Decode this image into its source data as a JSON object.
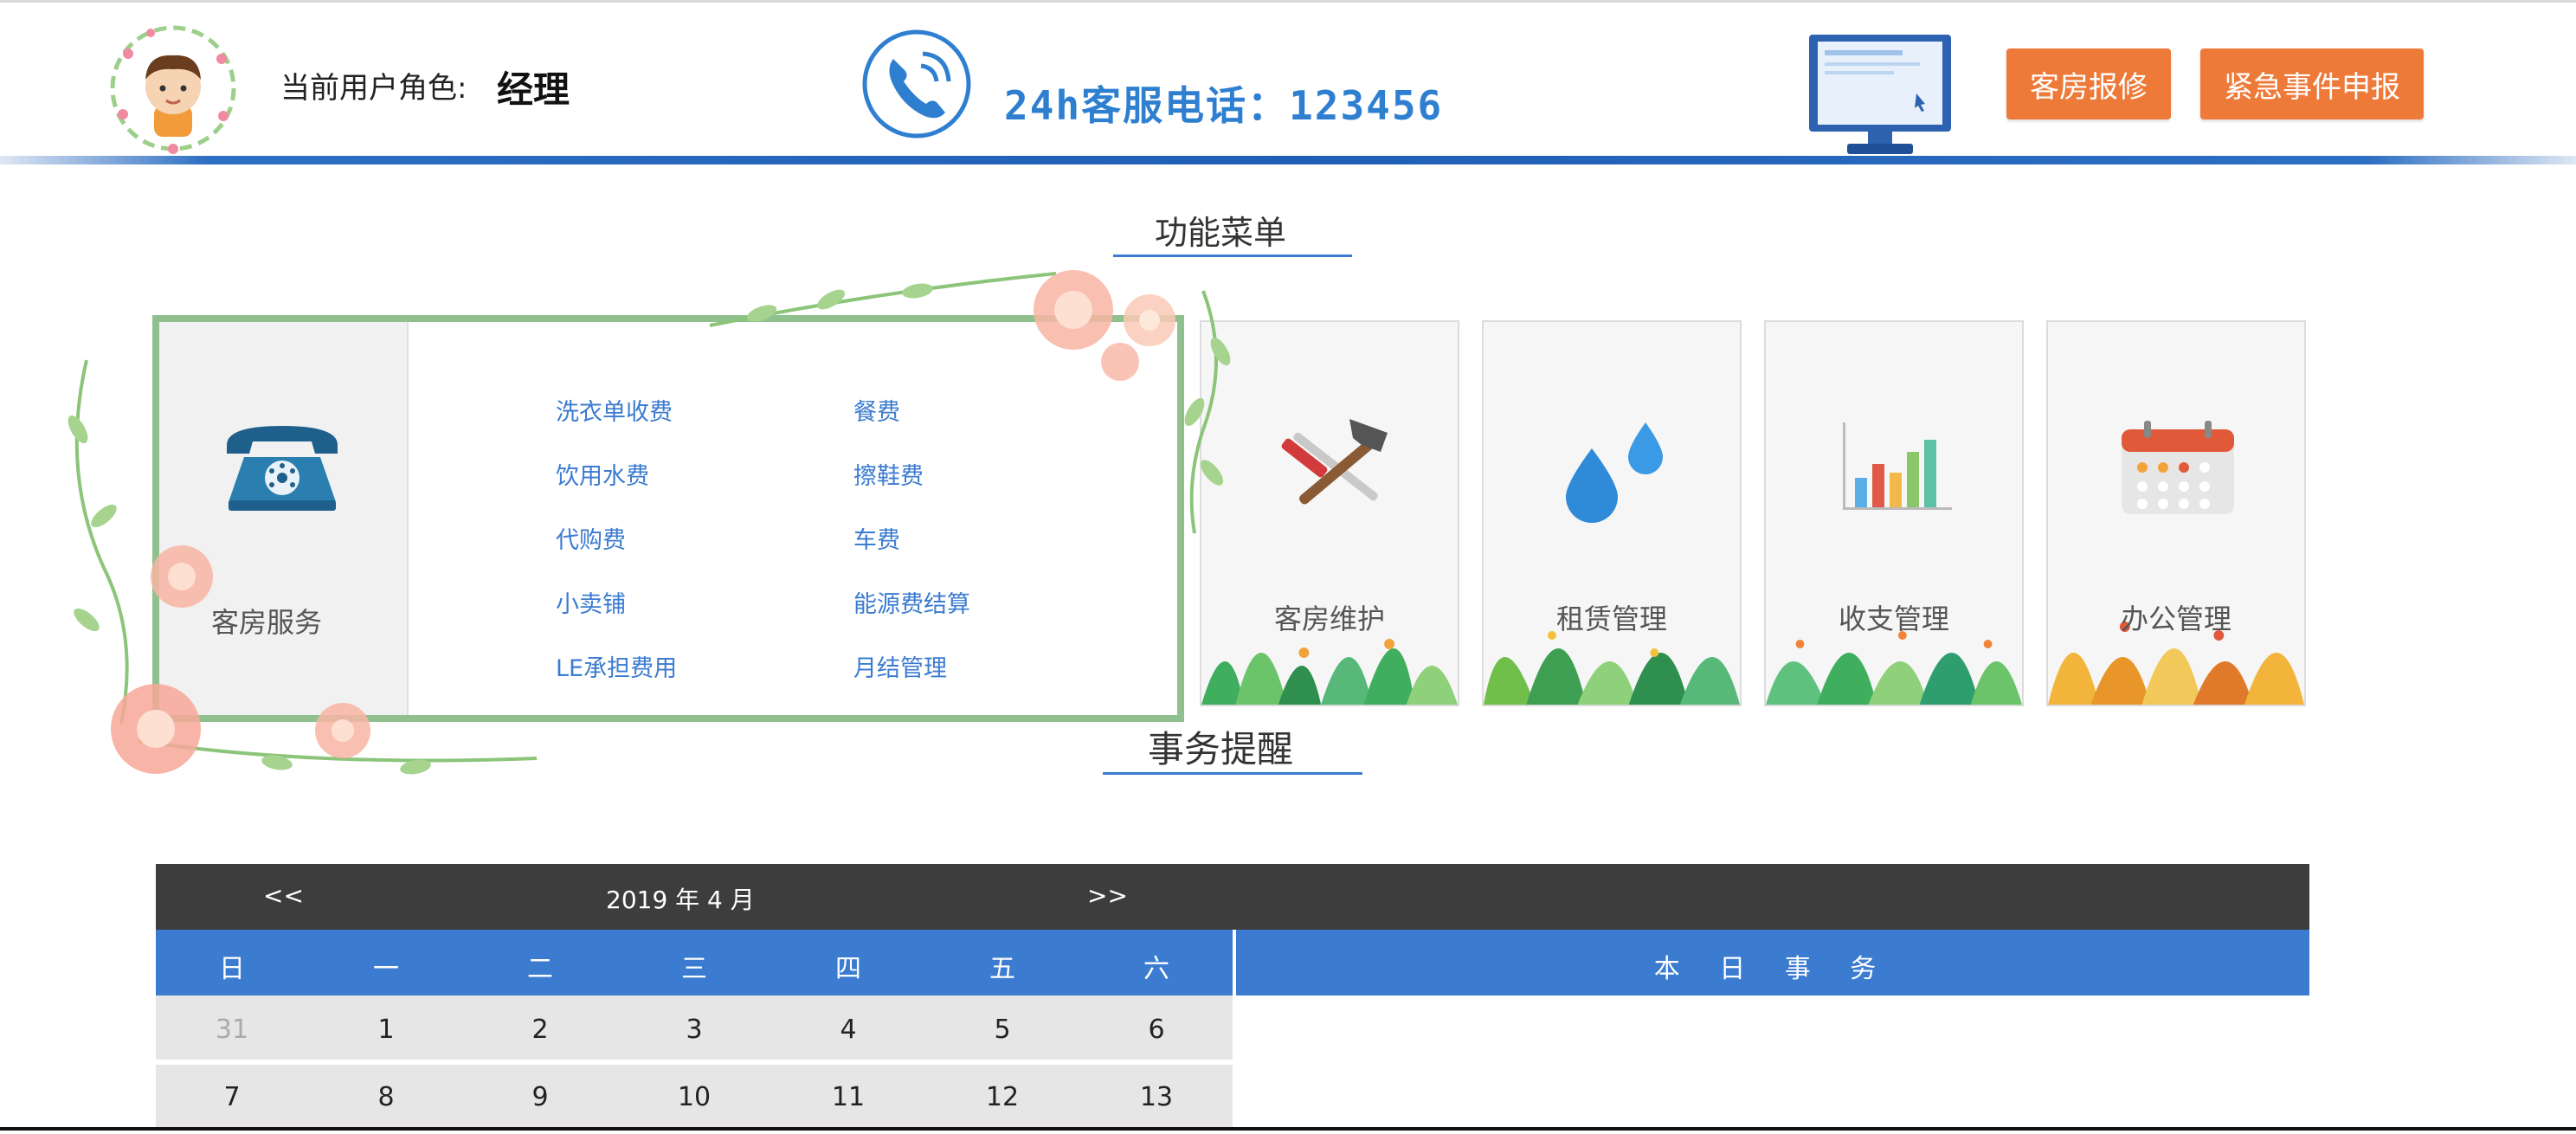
{
  "header": {
    "role_label": "当前用户角色:",
    "role_value": "经理",
    "hotline": "24h客服电话：123456",
    "buttons": {
      "repair": "客房报修",
      "emergency": "紧急事件申报"
    }
  },
  "menu": {
    "title": "功能菜单",
    "guest_service": {
      "label": "客房服务",
      "links": [
        "洗衣单收费",
        "餐费",
        "饮用水费",
        "擦鞋费",
        "代购费",
        "车费",
        "小卖铺",
        "能源费结算",
        "LE承担费用",
        "月结管理"
      ]
    },
    "cards": [
      {
        "label": "客房维护",
        "icon": "hammer-wrench-icon"
      },
      {
        "label": "租赁管理",
        "icon": "water-drops-icon"
      },
      {
        "label": "收支管理",
        "icon": "bar-chart-icon"
      },
      {
        "label": "办公管理",
        "icon": "calendar-icon"
      }
    ]
  },
  "reminder": {
    "title": "事务提醒",
    "calendar": {
      "prev": "<<",
      "next": ">>",
      "month_label": "2019 年 4 月",
      "weekdays": [
        "日",
        "一",
        "二",
        "三",
        "四",
        "五",
        "六"
      ],
      "rows": [
        [
          "31",
          "1",
          "2",
          "3",
          "4",
          "5",
          "6"
        ],
        [
          "7",
          "8",
          "9",
          "10",
          "11",
          "12",
          "13"
        ]
      ],
      "events_title": "本 日 事 务"
    }
  },
  "colors": {
    "accent_blue": "#3b7bd0",
    "button_orange": "#ee7a3a",
    "frame_green": "#8fc08e",
    "calendar_dark": "#3d3d3d"
  }
}
